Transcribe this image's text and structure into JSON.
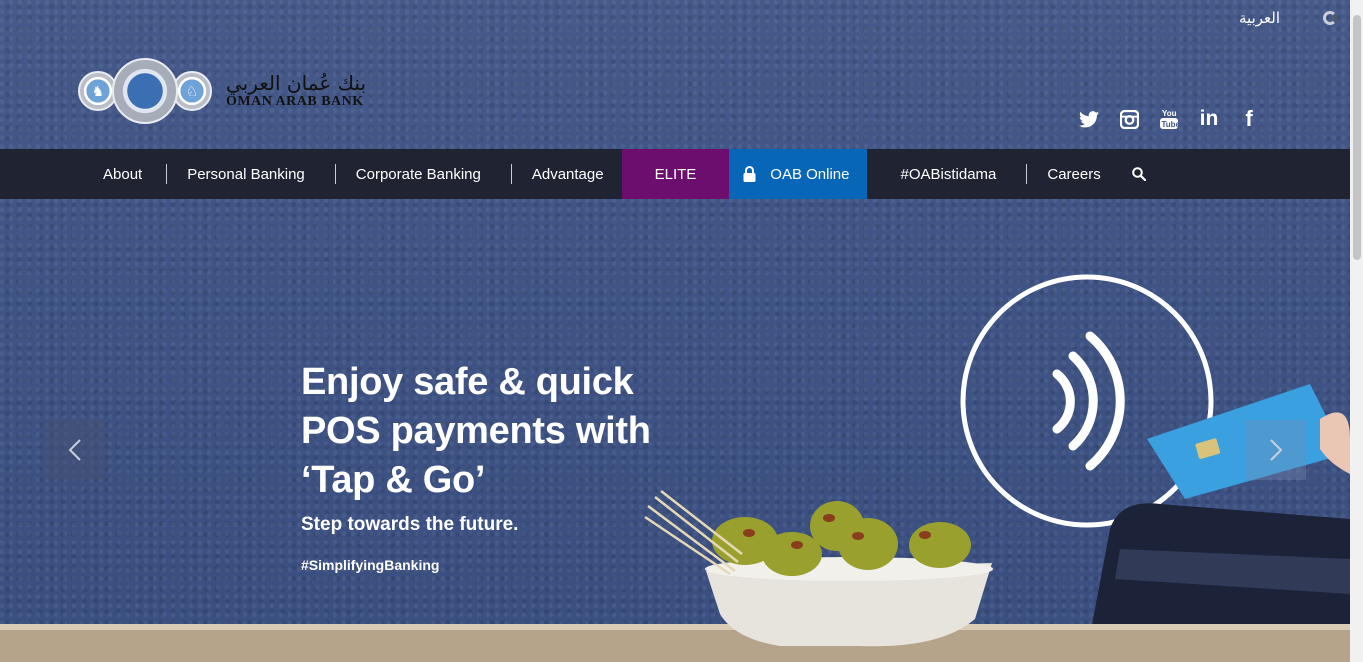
{
  "header": {
    "language_link": "العربية",
    "logo_arabic": "بنك عُمان العربي",
    "logo_english": "OMAN ARAB BANK"
  },
  "social": [
    {
      "name": "twitter-icon",
      "glyph": "🐦"
    },
    {
      "name": "instagram-icon",
      "glyph": "◙"
    },
    {
      "name": "youtube-icon",
      "glyph": "You\nTube"
    },
    {
      "name": "linkedin-icon",
      "glyph": "in"
    },
    {
      "name": "facebook-icon",
      "glyph": "f"
    }
  ],
  "nav": {
    "about": "About",
    "personal_banking": "Personal Banking",
    "corporate_banking": "Corporate Banking",
    "advantage": "Advantage",
    "elite": "ELITE",
    "oab_online": "OAB Online",
    "oabistidama": "#OABistidama",
    "careers": "Careers"
  },
  "hero": {
    "headline_line1": "Enjoy safe & quick",
    "headline_line2": "POS payments with",
    "headline_line3": "‘Tap & Go’",
    "subline": "Step towards the future.",
    "hashtag": "#SimplifyingBanking"
  },
  "colors": {
    "nav_bg": "#1f2332",
    "elite_bg": "#6b0e6e",
    "online_bg": "#0866b8",
    "page_bg": "#3f5485"
  }
}
